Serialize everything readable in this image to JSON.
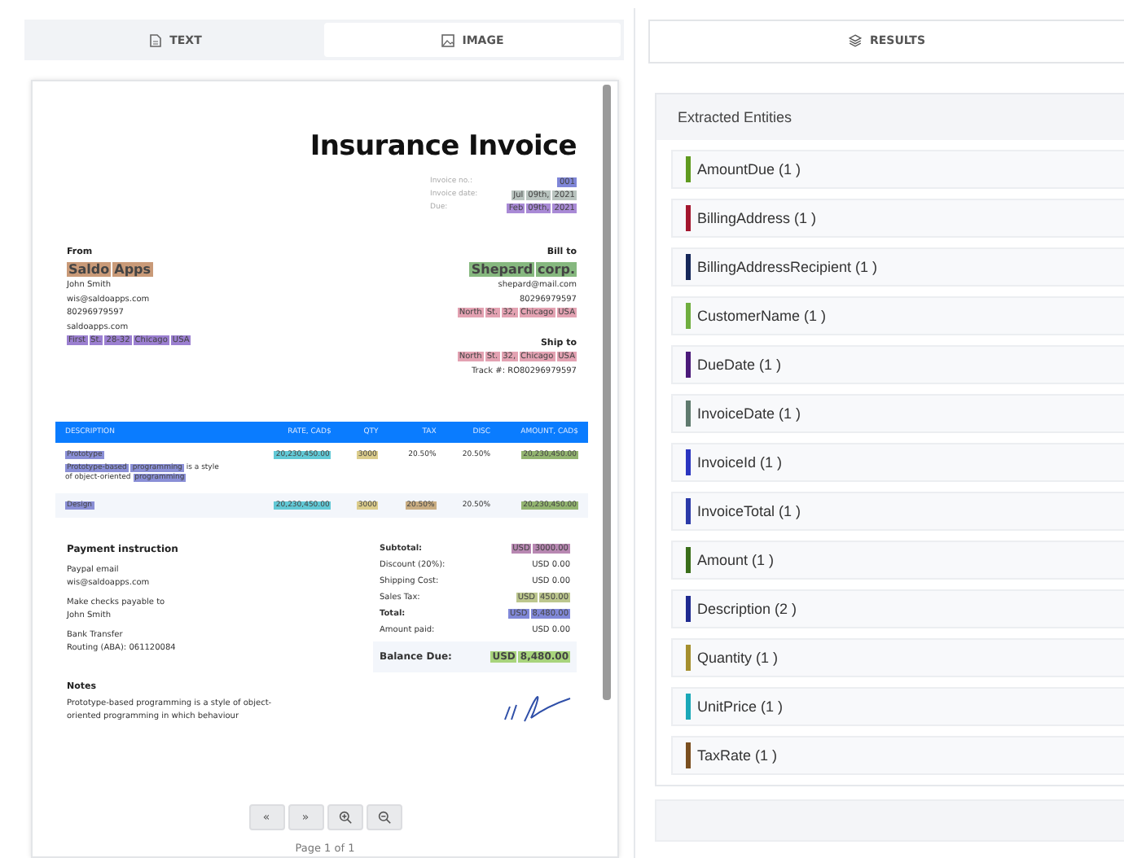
{
  "left_tabs": [
    {
      "label": "TEXT",
      "selected": false
    },
    {
      "label": "IMAGE",
      "selected": true
    }
  ],
  "document": {
    "title": "Insurance Invoice",
    "meta": [
      {
        "label": "Invoice no.:",
        "value": [
          {
            "text": "001",
            "color": "#7f86d8"
          }
        ]
      },
      {
        "label": "Invoice date:",
        "value": [
          {
            "text": "Jul",
            "color": "#b9c4bf"
          },
          {
            "text": "09th,",
            "color": "#b9c4bf"
          },
          {
            "text": "2021",
            "color": "#b9c4bf"
          }
        ]
      },
      {
        "label": "Due:",
        "value": [
          {
            "text": "Feb",
            "color": "#a98ad6"
          },
          {
            "text": "09th,",
            "color": "#a98ad6"
          },
          {
            "text": "2021",
            "color": "#a98ad6"
          }
        ]
      }
    ],
    "from": {
      "heading": "From",
      "name": [
        {
          "text": "Saldo",
          "color": "#c99a78"
        },
        {
          "text": "Apps",
          "color": "#c99a78"
        }
      ],
      "lines": [
        "John Smith",
        "wis@saldoapps.com",
        "80296979597",
        "saldoapps.com"
      ],
      "address": [
        {
          "text": "First",
          "color": "#9b7fd0"
        },
        {
          "text": "St.",
          "color": "#9b7fd0"
        },
        {
          "text": "28-32",
          "color": "#9b7fd0"
        },
        {
          "text": "Chicago",
          "color": "#9b7fd0"
        },
        {
          "text": "USA",
          "color": "#9b7fd0"
        }
      ]
    },
    "bill_to": {
      "heading": "Bill to",
      "name": [
        {
          "text": "Shepard",
          "color": "#86b87f"
        },
        {
          "text": "corp.",
          "color": "#86b87f"
        }
      ],
      "lines": [
        "shepard@mail.com",
        "80296979597"
      ],
      "address": [
        {
          "text": "North",
          "color": "#e3a2b2"
        },
        {
          "text": "St.",
          "color": "#e3a2b2"
        },
        {
          "text": "32,",
          "color": "#e3a2b2"
        },
        {
          "text": "Chicago",
          "color": "#e3a2b2"
        },
        {
          "text": "USA",
          "color": "#e3a2b2"
        }
      ]
    },
    "ship_to": {
      "heading": "Ship to",
      "address": [
        {
          "text": "North",
          "color": "#e3a2b2"
        },
        {
          "text": "St.",
          "color": "#e3a2b2"
        },
        {
          "text": "32,",
          "color": "#e3a2b2"
        },
        {
          "text": "Chicago",
          "color": "#e3a2b2"
        },
        {
          "text": "USA",
          "color": "#e3a2b2"
        }
      ],
      "track": "Track #: RO80296979597"
    },
    "table": {
      "columns": [
        "DESCRIPTION",
        "RATE, CAD$",
        "QTY",
        "TAX",
        "DISC",
        "AMOUNT, CAD$"
      ],
      "rows": [
        {
          "cells": [
            [
              {
                "text": "Prototype",
                "color": "#8a8fd6"
              }
            ],
            [
              {
                "text": "20,230,450.00",
                "color": "#62c9d6"
              }
            ],
            [
              {
                "text": "3000",
                "color": "#dccd8c"
              }
            ],
            [
              {
                "text": "20.50%"
              }
            ],
            [
              {
                "text": "20.50%"
              }
            ],
            [
              {
                "text": "20,230,450.00",
                "color": "#93b470"
              }
            ]
          ],
          "note": [
            {
              "text": "Prototype-based",
              "color": "#8a8fd6"
            },
            {
              "text": "programming",
              "color": "#8a8fd6"
            },
            {
              "text": "is a style"
            },
            {
              "text": "of object-oriented"
            },
            {
              "text": "programming",
              "color": "#8a8fd6"
            }
          ]
        },
        {
          "cells": [
            [
              {
                "text": "Design",
                "color": "#8a8fd6"
              }
            ],
            [
              {
                "text": "20,230,450.00",
                "color": "#62c9d6"
              }
            ],
            [
              {
                "text": "3000",
                "color": "#dccd8c"
              }
            ],
            [
              {
                "text": "20.50%",
                "color": "#c9ad82"
              }
            ],
            [
              {
                "text": "20.50%"
              }
            ],
            [
              {
                "text": "20,230,450.00",
                "color": "#93b470"
              }
            ]
          ]
        }
      ]
    },
    "payment": {
      "heading": "Payment instruction",
      "blocks": [
        [
          "Paypal email",
          "wis@saldoapps.com"
        ],
        [
          "Make checks payable to",
          "John Smith"
        ],
        [
          "Bank Transfer",
          "Routing (ABA): 061120084"
        ]
      ]
    },
    "totals": [
      {
        "label": "Subtotal:",
        "bold": true,
        "value": [
          {
            "text": "USD",
            "color": "#b888b2"
          },
          {
            "text": "3000.00",
            "color": "#b888b2"
          }
        ]
      },
      {
        "label": "Discount (20%):",
        "bold": false,
        "value": [
          {
            "text": "USD 0.00"
          }
        ]
      },
      {
        "label": "Shipping Cost:",
        "bold": false,
        "value": [
          {
            "text": "USD 0.00"
          }
        ]
      },
      {
        "label": "Sales Tax:",
        "bold": false,
        "value": [
          {
            "text": "USD",
            "color": "#bcc68e"
          },
          {
            "text": "450.00",
            "color": "#bcc68e"
          }
        ]
      },
      {
        "label": "Total:",
        "bold": true,
        "value": [
          {
            "text": "USD",
            "color": "#8088d8"
          },
          {
            "text": "8,480.00",
            "color": "#8088d8"
          }
        ]
      },
      {
        "label": "Amount paid:",
        "bold": false,
        "value": [
          {
            "text": "USD 0.00"
          }
        ]
      }
    ],
    "balance": {
      "label": "Balance Due:",
      "value": [
        {
          "text": "USD",
          "color": "#a8d47c"
        },
        {
          "text": "8,480.00",
          "color": "#a8d47c"
        }
      ]
    },
    "notes": {
      "heading": "Notes",
      "text": "Prototype-based programming is a style of object-oriented programming in which behaviour"
    }
  },
  "pager": {
    "buttons": [
      {
        "kind": "text",
        "label": "«"
      },
      {
        "kind": "text",
        "label": "»"
      },
      {
        "kind": "zoom-in"
      },
      {
        "kind": "zoom-out"
      }
    ],
    "page_label": "Page 1 of 1"
  },
  "right_tab": {
    "label": "RESULTS"
  },
  "entities": {
    "title": "Extracted Entities",
    "items": [
      {
        "name": "AmountDue (1 )",
        "color": "#5f9a1f"
      },
      {
        "name": "BillingAddress (1 )",
        "color": "#a3162e"
      },
      {
        "name": "BillingAddressRecipient (1 )",
        "color": "#16285a"
      },
      {
        "name": "CustomerName (1 )",
        "color": "#6fae3f"
      },
      {
        "name": "DueDate (1 )",
        "color": "#4b1a7a"
      },
      {
        "name": "InvoiceDate (1 )",
        "color": "#5f7a6e"
      },
      {
        "name": "InvoiceId (1 )",
        "color": "#2a35c0"
      },
      {
        "name": "InvoiceTotal (1 )",
        "color": "#2b3aa8"
      },
      {
        "name": "Amount (1 )",
        "color": "#3a6e1a"
      },
      {
        "name": "Description (2 )",
        "color": "#1f2a90"
      },
      {
        "name": "Quantity (1 )",
        "color": "#a58f2e"
      },
      {
        "name": "UnitPrice (1 )",
        "color": "#1aa8b8"
      },
      {
        "name": "TaxRate (1 )",
        "color": "#7a4f20"
      }
    ]
  }
}
